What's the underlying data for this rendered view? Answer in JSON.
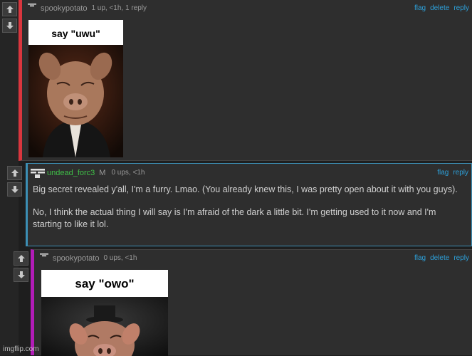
{
  "comments": [
    {
      "username": "spookypotato",
      "meta": "1 up, <1h, 1 reply",
      "actions": [
        "flag",
        "delete",
        "reply"
      ],
      "meme_caption": "say \"uwu\""
    },
    {
      "username": "undead_forc3",
      "mod_badge": "M",
      "meta": "0 ups, <1h",
      "actions": [
        "flag",
        "reply"
      ],
      "paragraphs": [
        "Big secret revealed y'all, I'm a furry. Lmao. (You already knew this, I was pretty open about it with you guys).",
        "No, I think the actual thing I will say is I'm afraid of the dark a little bit. I'm getting used to it now and I'm starting to like it lol."
      ]
    },
    {
      "username": "spookypotato",
      "meta": "0 ups, <1h",
      "actions": [
        "flag",
        "delete",
        "reply"
      ],
      "meme_caption": "say \"owo\""
    }
  ],
  "watermark": "imgflip.com",
  "icons": {
    "upvote": "arrow-up-icon",
    "downvote": "arrow-down-icon",
    "flair": "user-flair-icon"
  },
  "colors": {
    "background": "#1e1e1e",
    "comment_bg": "#2e2e2e",
    "comment1_border": "#d9363e",
    "comment2_border": "#3c8fb5",
    "comment3_border": "#b21cb8",
    "action_link": "#2d9fd8",
    "mod_username": "#3fbf47"
  }
}
